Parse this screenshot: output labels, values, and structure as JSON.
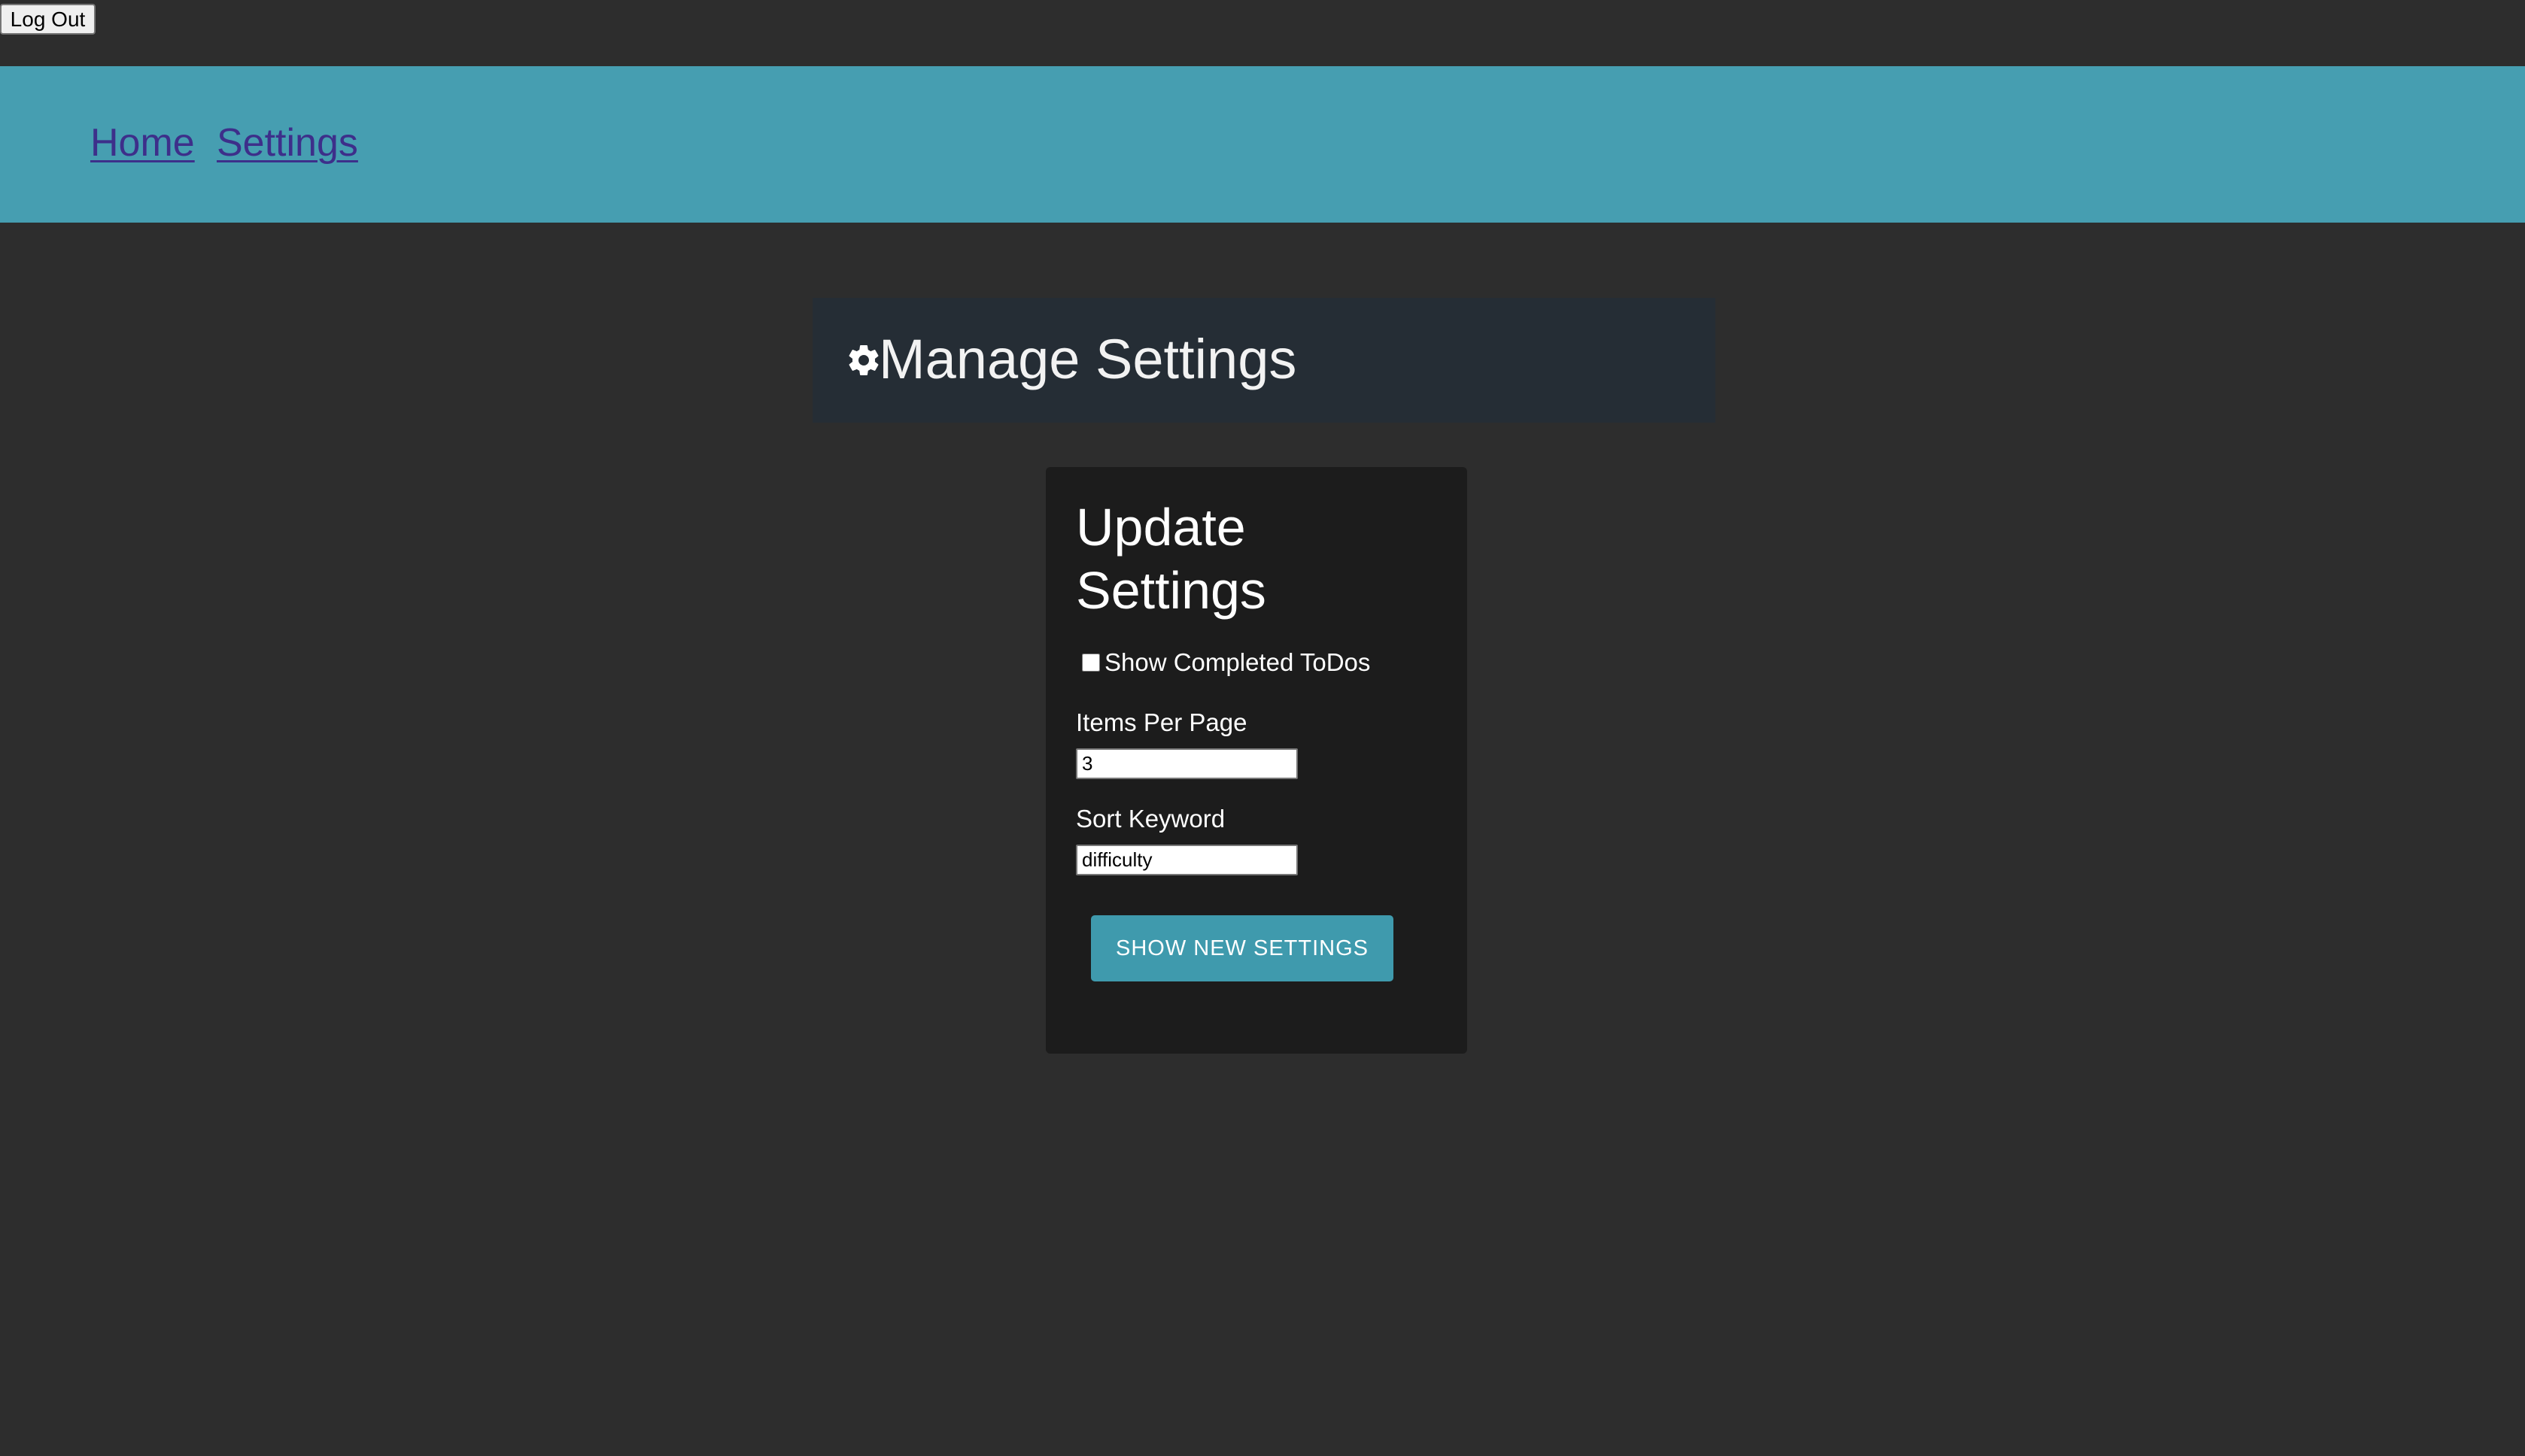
{
  "header": {
    "logout_label": "Log Out"
  },
  "nav": {
    "links": [
      {
        "label": "Home"
      },
      {
        "label": "Settings"
      }
    ]
  },
  "page": {
    "title": "Manage Settings",
    "title_icon": "gear-icon"
  },
  "settings_form": {
    "heading": "Update Settings",
    "show_completed": {
      "label": "Show Completed ToDos",
      "checked": false
    },
    "items_per_page": {
      "label": "Items Per Page",
      "value": "3"
    },
    "sort_keyword": {
      "label": "Sort Keyword",
      "value": "difficulty"
    },
    "submit_label": "SHOW NEW SETTINGS"
  },
  "colors": {
    "background": "#2d2d2d",
    "navbar": "#469eb1",
    "nav_link": "#3d2f8a",
    "title_bar": "#252d35",
    "card": "#1c1c1c",
    "accent_button": "#3f9aad"
  }
}
